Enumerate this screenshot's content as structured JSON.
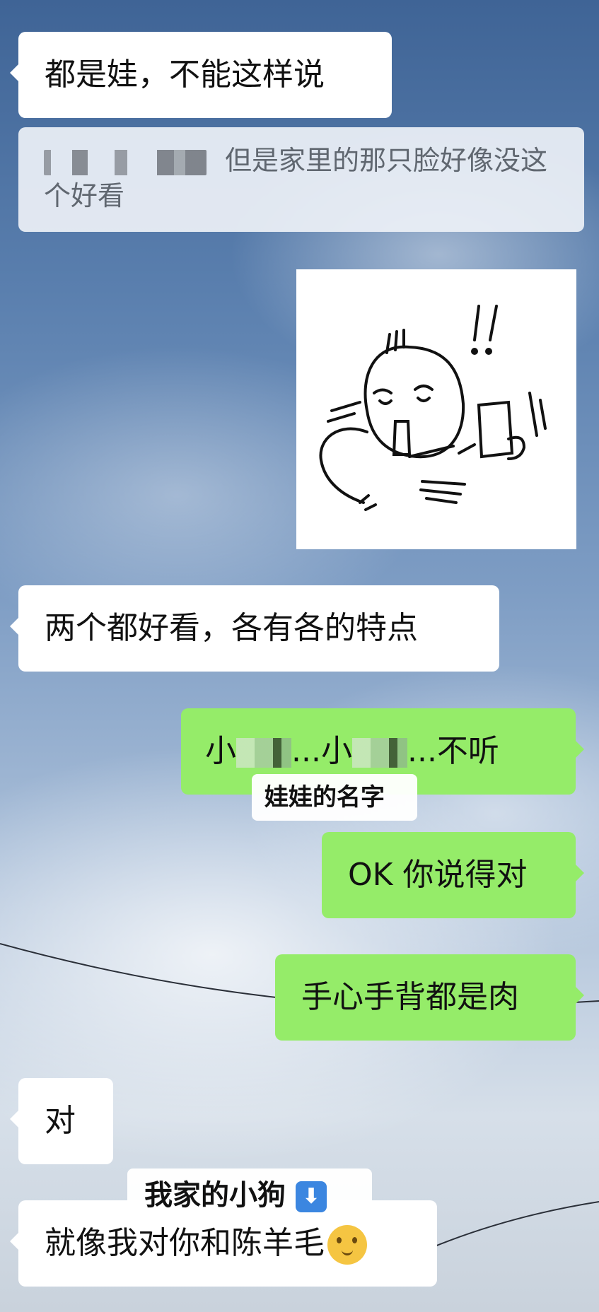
{
  "messages": {
    "m1": "都是娃，不能这样说",
    "m2_quote": "但是家里的那只脸好像没这个好看",
    "m3": "两个都好看，各有各的特点",
    "m4_start": "小",
    "m4_mid1": "...小",
    "m4_end": "...不听",
    "m5": "OK 你说得对",
    "m6": "手心手背都是肉",
    "m7": "对",
    "m8": "就像我对你和陈羊毛"
  },
  "captions": {
    "doll_name": "娃娃的名字",
    "my_dog": "我家的小狗"
  },
  "icons": {
    "down_arrow": "⬇",
    "emoji": "thinking-face-icon"
  },
  "colors": {
    "received_bubble": "#ffffff",
    "sent_bubble": "#95ec69",
    "quote_bg": "#ecf0f6"
  }
}
